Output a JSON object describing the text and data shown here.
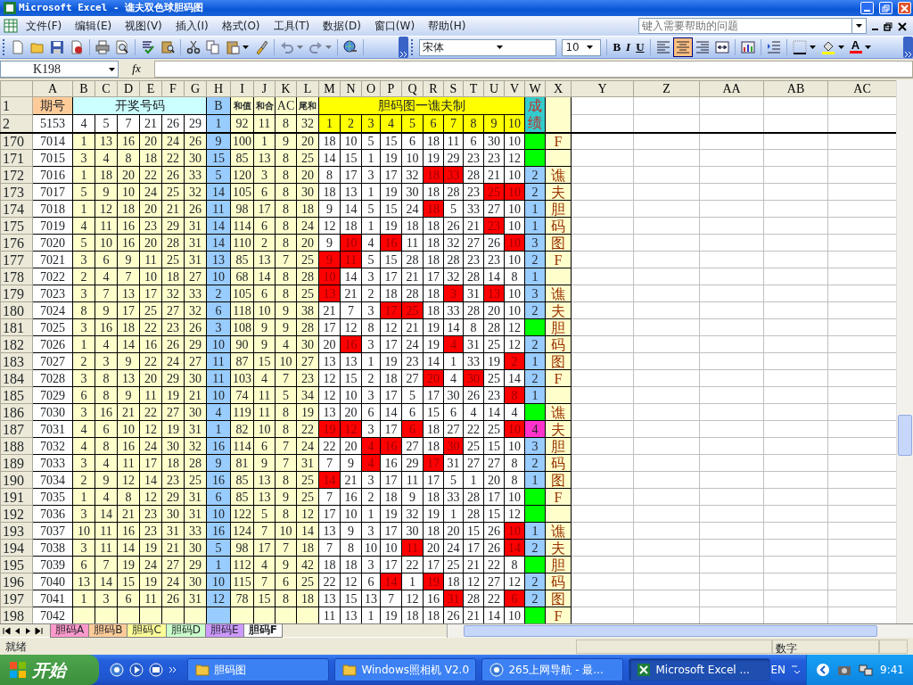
{
  "window": {
    "title": "Microsoft Excel - 谯夫双色球胆码图"
  },
  "menu": [
    "文件(F)",
    "编辑(E)",
    "视图(V)",
    "插入(I)",
    "格式(O)",
    "工具(T)",
    "数据(D)",
    "窗口(W)",
    "帮助(H)"
  ],
  "help_search": {
    "placeholder": "键入需要帮助的问题"
  },
  "toolbar": {
    "undo": {
      "disabled": true
    },
    "redo": {
      "disabled": true
    },
    "font": "宋体",
    "size": "10",
    "bold": "B",
    "italic": "I",
    "underline": "U",
    "font_color": "A",
    "align": [
      {
        "kind": "left",
        "selected": false
      },
      {
        "kind": "center",
        "selected": true
      },
      {
        "kind": "right",
        "selected": false
      }
    ]
  },
  "formula_bar": {
    "name_box": "K198",
    "function_label": "fx"
  },
  "sheet": {
    "columns": [
      "A",
      "B",
      "C",
      "D",
      "E",
      "F",
      "G",
      "H",
      "I",
      "J",
      "K",
      "L",
      "M",
      "N",
      "O",
      "P",
      "Q",
      "R",
      "S",
      "T",
      "U",
      "V",
      "W",
      "X",
      "Y",
      "Z",
      "AA",
      "AB",
      "AC"
    ],
    "header": {
      "n": "1",
      "period": "期号",
      "draw": "开奖号码",
      "blue": "B",
      "sum": "和值",
      "he": "和合",
      "ac": "AC",
      "tail": "尾和",
      "chart": "胆码图一谯夫制",
      "score": "成绩"
    },
    "row2": {
      "n": "2",
      "period": "5153",
      "balls": [
        "4",
        "5",
        "7",
        "21",
        "26",
        "29"
      ],
      "blue": "1",
      "sum": "92",
      "he": "11",
      "ac": "8",
      "tail": "32",
      "dan": [
        "1",
        "2",
        "3",
        "4",
        "5",
        "6",
        "7",
        "8",
        "9",
        "10"
      ]
    },
    "rows": [
      {
        "n": "170",
        "period": "7014",
        "balls": [
          "1",
          "13",
          "16",
          "20",
          "24",
          "26"
        ],
        "blue": "9",
        "sum": "100",
        "he": "1",
        "ac": "9",
        "tail": "20",
        "dan": [
          "18",
          "10",
          "5",
          "15",
          "6",
          "18",
          "11",
          "6",
          "30",
          "10"
        ],
        "hits": [
          false,
          false,
          false,
          false,
          false,
          false,
          false,
          false,
          false,
          false
        ],
        "score": {
          "color": "#00ff00"
        },
        "note": "F"
      },
      {
        "n": "171",
        "period": "7015",
        "balls": [
          "3",
          "4",
          "8",
          "18",
          "22",
          "30"
        ],
        "blue": "15",
        "sum": "85",
        "he": "13",
        "ac": "8",
        "tail": "25",
        "dan": [
          "14",
          "15",
          "1",
          "19",
          "10",
          "19",
          "29",
          "23",
          "23",
          "12"
        ],
        "hits": [
          false,
          false,
          false,
          false,
          false,
          false,
          false,
          false,
          false,
          false
        ],
        "score": {
          "color": "#00ff00"
        }
      },
      {
        "n": "172",
        "period": "7016",
        "balls": [
          "1",
          "18",
          "20",
          "22",
          "26",
          "33"
        ],
        "blue": "5",
        "sum": "120",
        "he": "3",
        "ac": "8",
        "tail": "20",
        "dan": [
          "8",
          "17",
          "3",
          "17",
          "32",
          "18",
          "33",
          "28",
          "21",
          "10"
        ],
        "hits": [
          false,
          false,
          false,
          false,
          false,
          true,
          true,
          false,
          false,
          false
        ],
        "score": {
          "text": "2",
          "color": "#99ccff"
        },
        "note": "谯"
      },
      {
        "n": "173",
        "period": "7017",
        "balls": [
          "5",
          "9",
          "10",
          "24",
          "25",
          "32"
        ],
        "blue": "14",
        "sum": "105",
        "he": "6",
        "ac": "8",
        "tail": "30",
        "dan": [
          "18",
          "13",
          "1",
          "19",
          "30",
          "18",
          "28",
          "23",
          "25",
          "10"
        ],
        "hits": [
          false,
          false,
          false,
          false,
          false,
          false,
          false,
          false,
          true,
          true
        ],
        "score": {
          "text": "2",
          "color": "#99ccff"
        },
        "note": "夫"
      },
      {
        "n": "174",
        "period": "7018",
        "balls": [
          "1",
          "12",
          "18",
          "20",
          "21",
          "26"
        ],
        "blue": "11",
        "sum": "98",
        "he": "17",
        "ac": "8",
        "tail": "18",
        "dan": [
          "9",
          "14",
          "5",
          "15",
          "24",
          "18",
          "5",
          "33",
          "27",
          "10"
        ],
        "hits": [
          false,
          false,
          false,
          false,
          false,
          true,
          false,
          false,
          false,
          false
        ],
        "score": {
          "text": "1",
          "color": "#99ccff"
        },
        "note": "胆"
      },
      {
        "n": "175",
        "period": "7019",
        "balls": [
          "4",
          "11",
          "16",
          "23",
          "29",
          "31"
        ],
        "blue": "14",
        "sum": "114",
        "he": "6",
        "ac": "8",
        "tail": "24",
        "dan": [
          "12",
          "18",
          "1",
          "19",
          "18",
          "18",
          "26",
          "21",
          "23",
          "10"
        ],
        "hits": [
          false,
          false,
          false,
          false,
          false,
          false,
          false,
          false,
          true,
          false
        ],
        "score": {
          "text": "1",
          "color": "#99ccff"
        },
        "note": "码"
      },
      {
        "n": "176",
        "period": "7020",
        "balls": [
          "5",
          "10",
          "16",
          "20",
          "28",
          "31"
        ],
        "blue": "14",
        "sum": "110",
        "he": "2",
        "ac": "8",
        "tail": "20",
        "dan": [
          "9",
          "10",
          "4",
          "16",
          "11",
          "18",
          "32",
          "27",
          "26",
          "10"
        ],
        "hits": [
          false,
          true,
          false,
          true,
          false,
          false,
          false,
          false,
          false,
          true
        ],
        "score": {
          "text": "3",
          "color": "#99ccff"
        },
        "note": "图"
      },
      {
        "n": "177",
        "period": "7021",
        "balls": [
          "3",
          "6",
          "9",
          "11",
          "25",
          "31"
        ],
        "blue": "13",
        "sum": "85",
        "he": "13",
        "ac": "7",
        "tail": "25",
        "dan": [
          "9",
          "11",
          "5",
          "15",
          "28",
          "18",
          "28",
          "23",
          "23",
          "10"
        ],
        "hits": [
          true,
          true,
          false,
          false,
          false,
          false,
          false,
          false,
          false,
          false
        ],
        "score": {
          "text": "2",
          "color": "#99ccff"
        },
        "note": "F"
      },
      {
        "n": "178",
        "period": "7022",
        "balls": [
          "2",
          "4",
          "7",
          "10",
          "18",
          "27"
        ],
        "blue": "10",
        "sum": "68",
        "he": "14",
        "ac": "8",
        "tail": "28",
        "dan": [
          "10",
          "14",
          "3",
          "17",
          "21",
          "17",
          "32",
          "28",
          "14",
          "8"
        ],
        "hits": [
          true,
          false,
          false,
          false,
          false,
          false,
          false,
          false,
          false,
          false
        ],
        "score": {
          "text": "1",
          "color": "#99ccff"
        }
      },
      {
        "n": "179",
        "period": "7023",
        "balls": [
          "3",
          "7",
          "13",
          "17",
          "32",
          "33"
        ],
        "blue": "2",
        "sum": "105",
        "he": "6",
        "ac": "8",
        "tail": "25",
        "dan": [
          "13",
          "21",
          "2",
          "18",
          "28",
          "18",
          "3",
          "31",
          "13",
          "10"
        ],
        "hits": [
          true,
          false,
          false,
          false,
          false,
          false,
          true,
          false,
          true,
          false
        ],
        "score": {
          "text": "3",
          "color": "#99ccff"
        },
        "note": "谯"
      },
      {
        "n": "180",
        "period": "7024",
        "balls": [
          "8",
          "9",
          "17",
          "25",
          "27",
          "32"
        ],
        "blue": "6",
        "sum": "118",
        "he": "10",
        "ac": "9",
        "tail": "38",
        "dan": [
          "21",
          "7",
          "3",
          "17",
          "25",
          "18",
          "33",
          "28",
          "20",
          "10"
        ],
        "hits": [
          false,
          false,
          false,
          true,
          true,
          false,
          false,
          false,
          false,
          false
        ],
        "score": {
          "text": "2",
          "color": "#99ccff"
        },
        "note": "夫"
      },
      {
        "n": "181",
        "period": "7025",
        "balls": [
          "3",
          "16",
          "18",
          "22",
          "23",
          "26"
        ],
        "blue": "3",
        "sum": "108",
        "he": "9",
        "ac": "9",
        "tail": "28",
        "dan": [
          "17",
          "12",
          "8",
          "12",
          "21",
          "19",
          "14",
          "8",
          "28",
          "12"
        ],
        "hits": [
          false,
          false,
          false,
          false,
          false,
          false,
          false,
          false,
          false,
          false
        ],
        "score": {
          "color": "#00ff00"
        },
        "note": "胆"
      },
      {
        "n": "182",
        "period": "7026",
        "balls": [
          "1",
          "4",
          "14",
          "16",
          "26",
          "29"
        ],
        "blue": "10",
        "sum": "90",
        "he": "9",
        "ac": "4",
        "tail": "30",
        "dan": [
          "20",
          "16",
          "3",
          "17",
          "24",
          "19",
          "4",
          "31",
          "25",
          "12"
        ],
        "hits": [
          false,
          true,
          false,
          false,
          false,
          false,
          true,
          false,
          false,
          false
        ],
        "score": {
          "text": "2",
          "color": "#99ccff"
        },
        "note": "码"
      },
      {
        "n": "183",
        "period": "7027",
        "balls": [
          "2",
          "3",
          "9",
          "22",
          "24",
          "27"
        ],
        "blue": "11",
        "sum": "87",
        "he": "15",
        "ac": "10",
        "tail": "27",
        "dan": [
          "13",
          "13",
          "1",
          "19",
          "23",
          "14",
          "1",
          "33",
          "19",
          "2"
        ],
        "hits": [
          false,
          false,
          false,
          false,
          false,
          false,
          false,
          false,
          false,
          true
        ],
        "score": {
          "text": "1",
          "color": "#99ccff"
        },
        "note": "图"
      },
      {
        "n": "184",
        "period": "7028",
        "balls": [
          "3",
          "8",
          "13",
          "20",
          "29",
          "30"
        ],
        "blue": "11",
        "sum": "103",
        "he": "4",
        "ac": "7",
        "tail": "23",
        "dan": [
          "12",
          "15",
          "2",
          "18",
          "27",
          "20",
          "4",
          "30",
          "25",
          "14"
        ],
        "hits": [
          false,
          false,
          false,
          false,
          false,
          true,
          false,
          true,
          false,
          false
        ],
        "score": {
          "text": "2",
          "color": "#99ccff"
        },
        "note": "F"
      },
      {
        "n": "185",
        "period": "7029",
        "balls": [
          "6",
          "8",
          "9",
          "11",
          "19",
          "21"
        ],
        "blue": "10",
        "sum": "74",
        "he": "11",
        "ac": "5",
        "tail": "34",
        "dan": [
          "12",
          "10",
          "3",
          "17",
          "5",
          "17",
          "30",
          "26",
          "23",
          "8"
        ],
        "hits": [
          false,
          false,
          false,
          false,
          false,
          false,
          false,
          false,
          false,
          true
        ],
        "score": {
          "text": "1",
          "color": "#99ccff"
        }
      },
      {
        "n": "186",
        "period": "7030",
        "balls": [
          "3",
          "16",
          "21",
          "22",
          "27",
          "30"
        ],
        "blue": "4",
        "sum": "119",
        "he": "11",
        "ac": "8",
        "tail": "19",
        "dan": [
          "13",
          "20",
          "6",
          "14",
          "6",
          "15",
          "6",
          "4",
          "14",
          "4"
        ],
        "hits": [
          false,
          false,
          false,
          false,
          false,
          false,
          false,
          false,
          false,
          false
        ],
        "score": {
          "color": "#00ff00"
        },
        "note": "谯"
      },
      {
        "n": "187",
        "period": "7031",
        "balls": [
          "4",
          "6",
          "10",
          "12",
          "19",
          "31"
        ],
        "blue": "1",
        "sum": "82",
        "he": "10",
        "ac": "8",
        "tail": "22",
        "dan": [
          "19",
          "12",
          "3",
          "17",
          "6",
          "18",
          "27",
          "22",
          "25",
          "10"
        ],
        "hits": [
          true,
          true,
          false,
          false,
          true,
          false,
          false,
          false,
          false,
          true
        ],
        "score": {
          "text": "4",
          "color": "#ff33cc"
        },
        "note": "夫"
      },
      {
        "n": "188",
        "period": "7032",
        "balls": [
          "4",
          "8",
          "16",
          "24",
          "30",
          "32"
        ],
        "blue": "16",
        "sum": "114",
        "he": "6",
        "ac": "7",
        "tail": "24",
        "dan": [
          "22",
          "20",
          "4",
          "16",
          "27",
          "18",
          "30",
          "25",
          "15",
          "10"
        ],
        "hits": [
          false,
          false,
          true,
          true,
          false,
          false,
          true,
          false,
          false,
          false
        ],
        "score": {
          "text": "3",
          "color": "#99ccff"
        },
        "note": "胆"
      },
      {
        "n": "189",
        "period": "7033",
        "balls": [
          "3",
          "4",
          "11",
          "17",
          "18",
          "28"
        ],
        "blue": "9",
        "sum": "81",
        "he": "9",
        "ac": "7",
        "tail": "31",
        "dan": [
          "7",
          "9",
          "4",
          "16",
          "29",
          "17",
          "31",
          "27",
          "27",
          "8"
        ],
        "hits": [
          false,
          false,
          true,
          false,
          false,
          true,
          false,
          false,
          false,
          false
        ],
        "score": {
          "text": "2",
          "color": "#99ccff"
        },
        "note": "码"
      },
      {
        "n": "190",
        "period": "7034",
        "balls": [
          "2",
          "9",
          "12",
          "14",
          "23",
          "25"
        ],
        "blue": "16",
        "sum": "85",
        "he": "13",
        "ac": "8",
        "tail": "25",
        "dan": [
          "14",
          "21",
          "3",
          "17",
          "11",
          "17",
          "5",
          "1",
          "20",
          "8"
        ],
        "hits": [
          true,
          false,
          false,
          false,
          false,
          false,
          false,
          false,
          false,
          false
        ],
        "score": {
          "text": "1",
          "color": "#99ccff"
        },
        "note": "图"
      },
      {
        "n": "191",
        "period": "7035",
        "balls": [
          "1",
          "4",
          "8",
          "12",
          "29",
          "31"
        ],
        "blue": "6",
        "sum": "85",
        "he": "13",
        "ac": "9",
        "tail": "25",
        "dan": [
          "7",
          "16",
          "2",
          "18",
          "9",
          "18",
          "33",
          "28",
          "17",
          "10"
        ],
        "hits": [
          false,
          false,
          false,
          false,
          false,
          false,
          false,
          false,
          false,
          false
        ],
        "score": {
          "color": "#00ff00"
        },
        "note": "F"
      },
      {
        "n": "192",
        "period": "7036",
        "balls": [
          "3",
          "14",
          "21",
          "23",
          "30",
          "31"
        ],
        "blue": "10",
        "sum": "122",
        "he": "5",
        "ac": "8",
        "tail": "12",
        "dan": [
          "17",
          "10",
          "1",
          "19",
          "32",
          "19",
          "1",
          "28",
          "15",
          "12"
        ],
        "hits": [
          false,
          false,
          false,
          false,
          false,
          false,
          false,
          false,
          false,
          false
        ],
        "score": {
          "color": "#00ff00"
        }
      },
      {
        "n": "193",
        "period": "7037",
        "balls": [
          "10",
          "11",
          "16",
          "23",
          "31",
          "33"
        ],
        "blue": "16",
        "sum": "124",
        "he": "7",
        "ac": "10",
        "tail": "14",
        "dan": [
          "13",
          "9",
          "3",
          "17",
          "30",
          "18",
          "20",
          "15",
          "26",
          "10"
        ],
        "hits": [
          false,
          false,
          false,
          false,
          false,
          false,
          false,
          false,
          false,
          true
        ],
        "score": {
          "text": "1",
          "color": "#99ccff"
        },
        "note": "谯"
      },
      {
        "n": "194",
        "period": "7038",
        "balls": [
          "3",
          "11",
          "14",
          "19",
          "21",
          "30"
        ],
        "blue": "5",
        "sum": "98",
        "he": "17",
        "ac": "7",
        "tail": "18",
        "dan": [
          "7",
          "8",
          "10",
          "10",
          "11",
          "20",
          "24",
          "17",
          "26",
          "14"
        ],
        "hits": [
          false,
          false,
          false,
          false,
          true,
          false,
          false,
          false,
          false,
          true
        ],
        "score": {
          "text": "2",
          "color": "#99ccff"
        },
        "note": "夫"
      },
      {
        "n": "195",
        "period": "7039",
        "balls": [
          "6",
          "7",
          "19",
          "24",
          "27",
          "29"
        ],
        "blue": "1",
        "sum": "112",
        "he": "4",
        "ac": "9",
        "tail": "42",
        "dan": [
          "18",
          "18",
          "3",
          "17",
          "22",
          "17",
          "25",
          "21",
          "22",
          "8"
        ],
        "hits": [
          false,
          false,
          false,
          false,
          false,
          false,
          false,
          false,
          false,
          false
        ],
        "score": {
          "color": "#00ff00"
        },
        "note": "胆"
      },
      {
        "n": "196",
        "period": "7040",
        "balls": [
          "13",
          "14",
          "15",
          "19",
          "24",
          "30"
        ],
        "blue": "10",
        "sum": "115",
        "he": "7",
        "ac": "6",
        "tail": "25",
        "dan": [
          "22",
          "12",
          "6",
          "14",
          "1",
          "19",
          "18",
          "12",
          "27",
          "12"
        ],
        "hits": [
          false,
          false,
          false,
          true,
          false,
          true,
          false,
          false,
          false,
          false
        ],
        "score": {
          "text": "2",
          "color": "#99ccff"
        },
        "note": "码"
      },
      {
        "n": "197",
        "period": "7041",
        "balls": [
          "1",
          "3",
          "6",
          "11",
          "26",
          "31"
        ],
        "blue": "12",
        "sum": "78",
        "he": "15",
        "ac": "8",
        "tail": "18",
        "dan": [
          "13",
          "15",
          "13",
          "7",
          "12",
          "16",
          "31",
          "28",
          "22",
          "6"
        ],
        "hits": [
          false,
          false,
          false,
          false,
          false,
          false,
          true,
          false,
          false,
          true
        ],
        "score": {
          "text": "2",
          "color": "#99ccff"
        },
        "note": "图"
      },
      {
        "n": "198",
        "period": "7042",
        "dan": [
          "11",
          "13",
          "1",
          "19",
          "18",
          "18",
          "26",
          "21",
          "14",
          "10"
        ],
        "hits": [
          false,
          false,
          false,
          false,
          false,
          false,
          false,
          false,
          false,
          false
        ],
        "score": {
          "color": "#00ff00"
        },
        "note": "F"
      }
    ]
  },
  "sheet_tabs": [
    {
      "label": "胆码A",
      "color": "#ff99cc",
      "selected": false
    },
    {
      "label": "胆码B",
      "color": "#ffcc99",
      "selected": false
    },
    {
      "label": "胆码C",
      "color": "#ffff99",
      "selected": false
    },
    {
      "label": "胆码D",
      "color": "#ccffcc",
      "selected": false
    },
    {
      "label": "胆码E",
      "color": "#cc99ff",
      "selected": false
    },
    {
      "label": "胆码F",
      "selected": true
    }
  ],
  "status_bar": {
    "left": "就绪",
    "mode": "数字"
  },
  "taskbar": {
    "start": "开始",
    "items": [
      {
        "label": "胆码图",
        "kind": "folder",
        "selected": false
      },
      {
        "label": "Windows照相机 V2.0",
        "kind": "folder",
        "selected": false
      },
      {
        "label": "265上网导航 - 最...",
        "kind": "browser",
        "selected": false
      },
      {
        "label": "Microsoft Excel ...",
        "kind": "excel",
        "selected": true
      }
    ],
    "language": "EN",
    "clock": "9:41"
  }
}
